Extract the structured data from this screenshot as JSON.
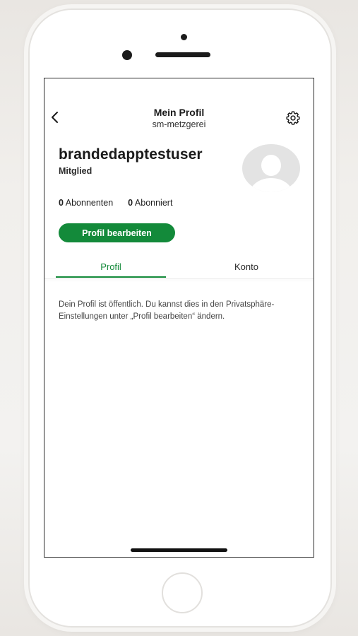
{
  "header": {
    "title": "Mein Profil",
    "subtitle": "sm-metzgerei"
  },
  "icons": {
    "back": "chevron-left-icon",
    "settings": "gear-icon",
    "avatar": "user-silhouette-icon"
  },
  "profile": {
    "username": "brandedapptestuser",
    "role": "Mitglied",
    "followers_count": "0",
    "followers_label": "Abonnenten",
    "following_count": "0",
    "following_label": "Abonniert",
    "edit_button": "Profil bearbeiten"
  },
  "tabs": [
    {
      "label": "Profil",
      "active": true
    },
    {
      "label": "Konto",
      "active": false
    }
  ],
  "info_text": "Dein Profil ist öffentlich. Du kannst dies in den Privatsphäre-Einstellungen unter „Profil bearbeiten“ ändern.",
  "colors": {
    "accent": "#138a3a",
    "text": "#1a1a1a",
    "avatar_bg": "#e3e3e3"
  }
}
